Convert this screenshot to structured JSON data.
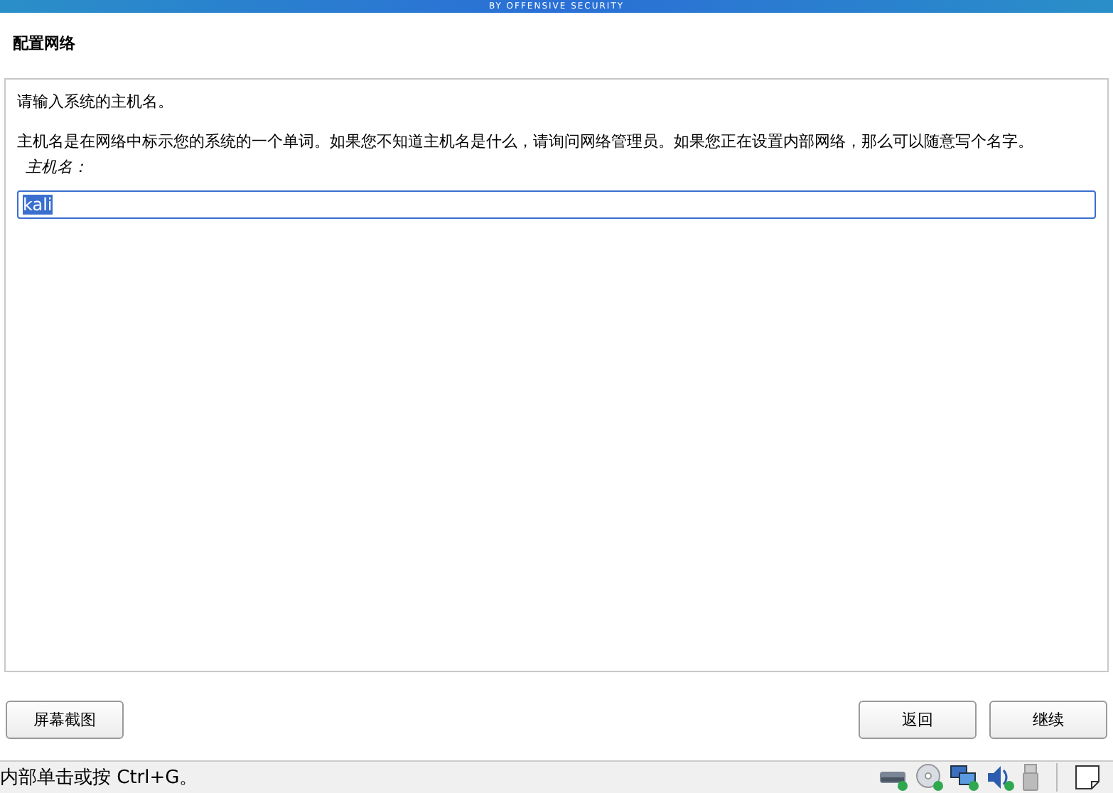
{
  "banner": {
    "text": "BY OFFENSIVE SECURITY"
  },
  "page_title": "配置网络",
  "panel": {
    "intro": "请输入系统的主机名。",
    "description": "主机名是在网络中标示您的系统的一个单词。如果您不知道主机名是什么，请询问网络管理员。如果您正在设置内部网络，那么可以随意写个名字。",
    "field_label": "主机名：",
    "field_value": "kali"
  },
  "buttons": {
    "left": [
      {
        "label": "屏幕截图"
      }
    ],
    "right": [
      {
        "label": "返回"
      },
      {
        "label": "继续"
      }
    ]
  },
  "status_bar": {
    "hint": "内部单击或按 Ctrl+G。"
  }
}
